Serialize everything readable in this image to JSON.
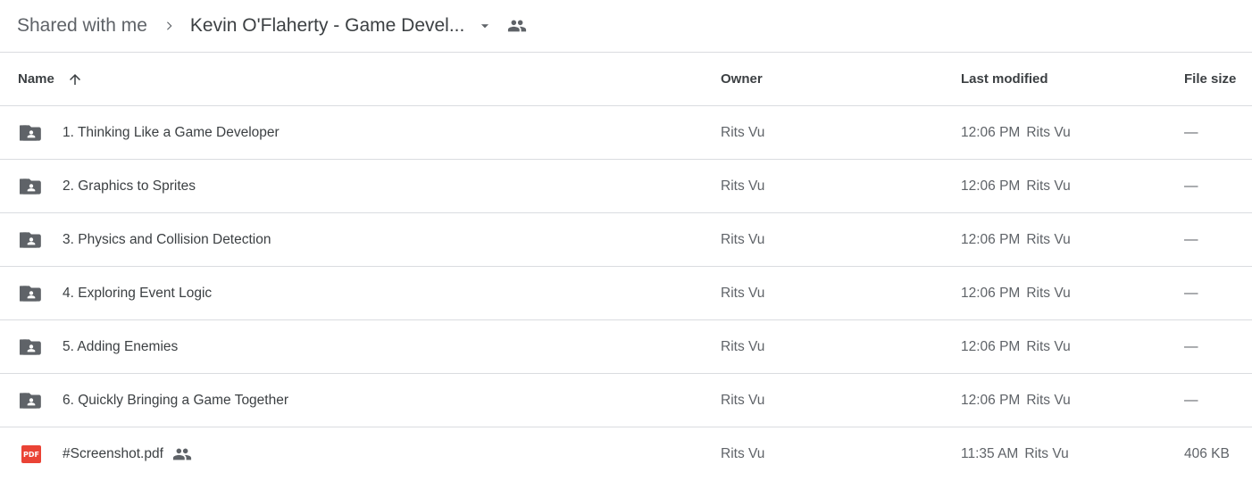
{
  "breadcrumb": {
    "root": "Shared with me",
    "current": "Kevin O'Flaherty - Game Devel...",
    "separator_icon": "chevron-right-icon",
    "dropdown_icon": "caret-down-icon",
    "shared_icon": "people-icon"
  },
  "columns": {
    "name": "Name",
    "owner": "Owner",
    "modified": "Last modified",
    "size": "File size",
    "sort_icon": "arrow-up-icon"
  },
  "rows": [
    {
      "type": "shared-folder",
      "name": "1. Thinking Like a Game Developer",
      "owner": "Rits Vu",
      "modified_time": "12:06 PM",
      "modified_by": "Rits Vu",
      "size": "—"
    },
    {
      "type": "shared-folder",
      "name": "2. Graphics to Sprites",
      "owner": "Rits Vu",
      "modified_time": "12:06 PM",
      "modified_by": "Rits Vu",
      "size": "—"
    },
    {
      "type": "shared-folder",
      "name": "3. Physics and Collision Detection",
      "owner": "Rits Vu",
      "modified_time": "12:06 PM",
      "modified_by": "Rits Vu",
      "size": "—"
    },
    {
      "type": "shared-folder",
      "name": "4. Exploring Event Logic",
      "owner": "Rits Vu",
      "modified_time": "12:06 PM",
      "modified_by": "Rits Vu",
      "size": "—"
    },
    {
      "type": "shared-folder",
      "name": "5. Adding Enemies",
      "owner": "Rits Vu",
      "modified_time": "12:06 PM",
      "modified_by": "Rits Vu",
      "size": "—"
    },
    {
      "type": "shared-folder",
      "name": "6. Quickly Bringing a Game Together",
      "owner": "Rits Vu",
      "modified_time": "12:06 PM",
      "modified_by": "Rits Vu",
      "size": "—"
    },
    {
      "type": "pdf",
      "name": "#Screenshot.pdf",
      "badge": "PDF",
      "shared": true,
      "owner": "Rits Vu",
      "modified_time": "11:35 AM",
      "modified_by": "Rits Vu",
      "size": "406 KB"
    }
  ],
  "colors": {
    "folder": "#5f6368",
    "pdf": "#ea4335",
    "divider": "#dadce0"
  }
}
